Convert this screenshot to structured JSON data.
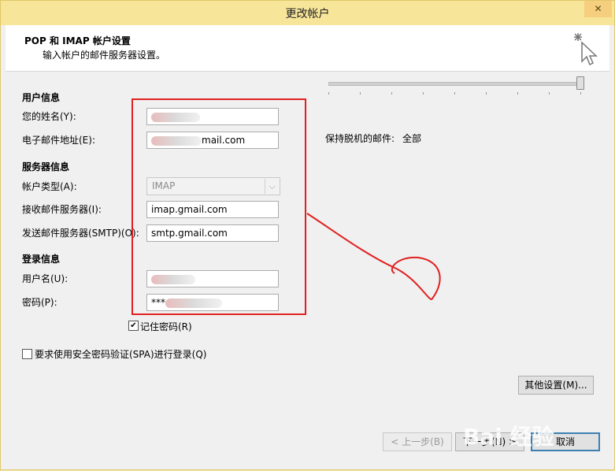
{
  "window": {
    "title": "更改帐户",
    "close_label": "✕"
  },
  "header": {
    "title": "POP 和 IMAP 帐户设置",
    "subtitle": "输入帐户的邮件服务器设置。"
  },
  "user_info": {
    "section_label": "用户信息",
    "name_label": "您的姓名(Y):",
    "email_label": "电子邮件地址(E):",
    "email_value": "mail.com"
  },
  "server_info": {
    "section_label": "服务器信息",
    "account_type_label": "帐户类型(A):",
    "account_type_value": "IMAP",
    "incoming_label": "接收邮件服务器(I):",
    "incoming_value": "imap.gmail.com",
    "outgoing_label": "发送邮件服务器(SMTP)(O):",
    "outgoing_value": "smtp.gmail.com"
  },
  "login_info": {
    "section_label": "登录信息",
    "username_label": "用户名(U):",
    "password_label": "密码(P):",
    "password_value": "***",
    "remember_label": "记住密码(R)",
    "remember_checked": "✔"
  },
  "spa": {
    "label": "要求使用安全密码验证(SPA)进行登录(Q)"
  },
  "offline": {
    "label": "保持脱机的邮件:",
    "value": "全部",
    "level": 1.0
  },
  "buttons": {
    "more_settings": "其他设置(M)...",
    "back": "< 上一步(B)",
    "next": "下一步(N) >",
    "cancel": "取消"
  },
  "watermark": "Bai 经验",
  "colors": {
    "annotation_red": "#e02020",
    "titlebar": "#f7e59a"
  }
}
